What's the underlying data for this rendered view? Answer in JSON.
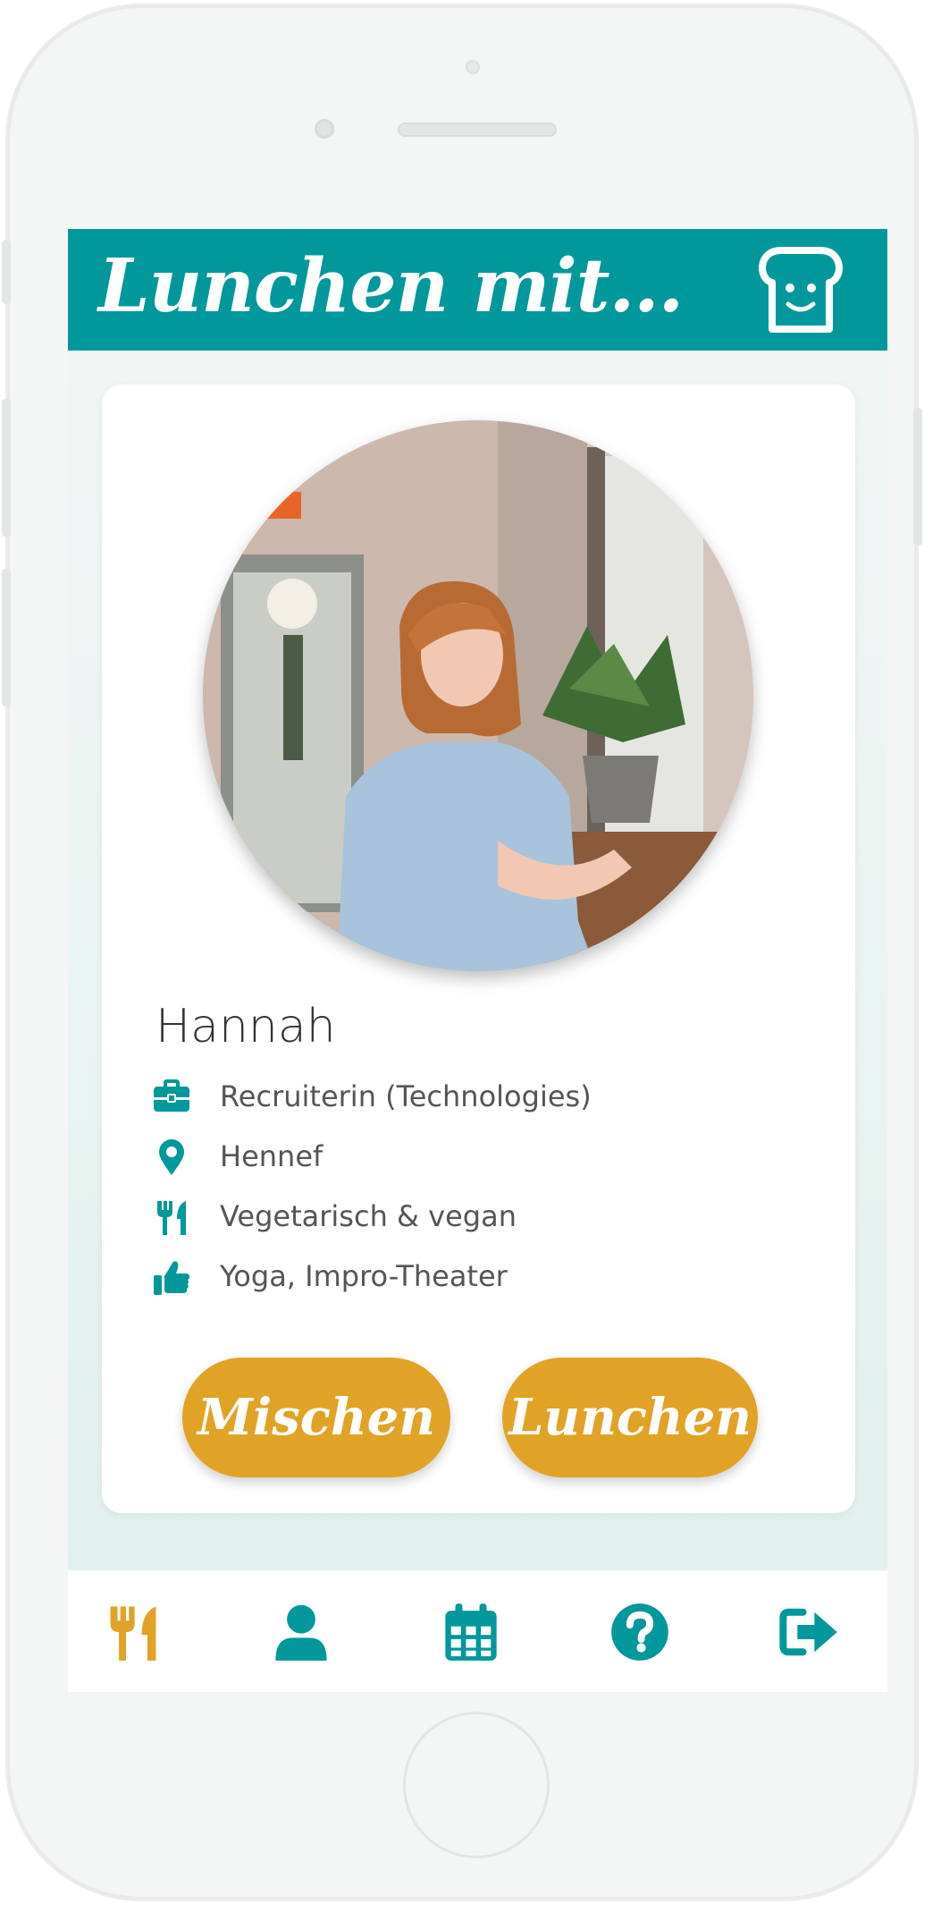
{
  "app": {
    "title": "Lunchen mit...",
    "accent_color": "#00989a",
    "button_color": "#e0a326",
    "header_icon": "toast-face-icon"
  },
  "profile": {
    "name": "Hannah",
    "photo": "profile-photo",
    "details": [
      {
        "icon": "briefcase-icon",
        "text": "Recruiterin (Technologies)"
      },
      {
        "icon": "map-pin-icon",
        "text": "Hennef"
      },
      {
        "icon": "utensils-icon",
        "text": "Vegetarisch & vegan"
      },
      {
        "icon": "thumbs-up-icon",
        "text": "Yoga, Impro-Theater"
      }
    ]
  },
  "actions": {
    "shuffle_label": "Mischen",
    "lunch_label": "Lunchen"
  },
  "bottom_nav": {
    "active": "utensils-icon",
    "items": [
      {
        "icon": "utensils-icon",
        "active_color": "#e0a326"
      },
      {
        "icon": "user-icon"
      },
      {
        "icon": "calendar-icon"
      },
      {
        "icon": "help-icon"
      },
      {
        "icon": "logout-icon"
      }
    ]
  }
}
